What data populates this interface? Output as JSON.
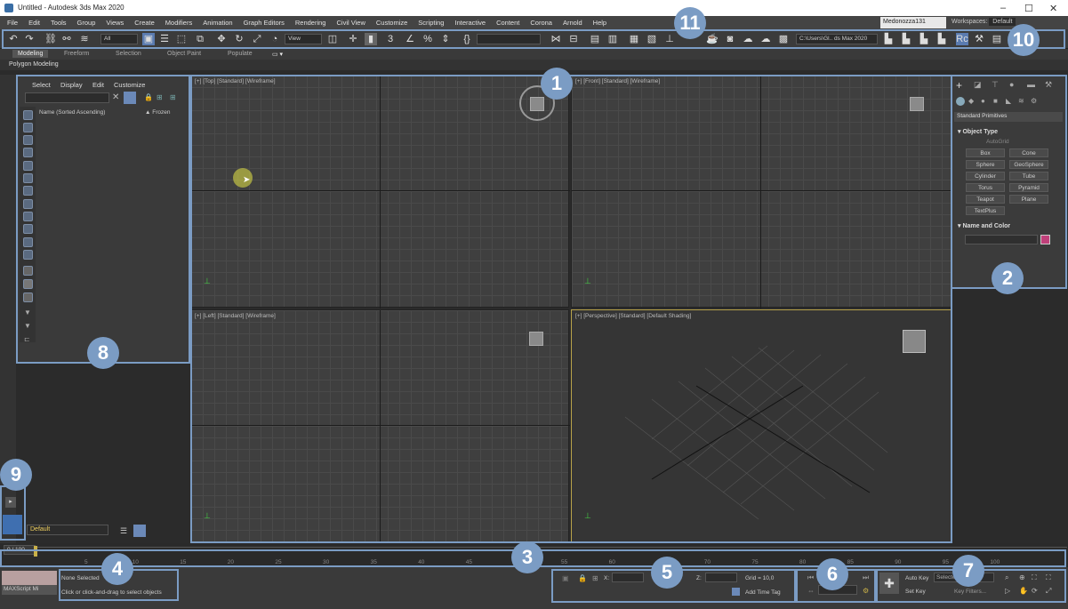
{
  "window": {
    "title": "Untitled - Autodesk 3ds Max 2020",
    "minimize": "–",
    "maximize": "☐",
    "close": "✕"
  },
  "menu": [
    "File",
    "Edit",
    "Tools",
    "Group",
    "Views",
    "Create",
    "Modifiers",
    "Animation",
    "Graph Editors",
    "Rendering",
    "Civil View",
    "Customize",
    "Scripting",
    "Interactive",
    "Content",
    "Corona",
    "Arnold",
    "Help"
  ],
  "user": "Medonozza131",
  "workspaces_label": "Workspaces:",
  "workspaces_value": "Default",
  "toolbar": {
    "selection_filter": "All",
    "ref_coord": "View",
    "path": "C:\\Users\\Gl.. ds Max 2020"
  },
  "ribbon_tabs": [
    "Modeling",
    "Freeform",
    "Selection",
    "Object Paint",
    "Populate"
  ],
  "ribbon_sub": "Polygon Modeling",
  "explorer": {
    "menu": [
      "Select",
      "Display",
      "Edit",
      "Customize"
    ],
    "col_name": "Name (Sorted Ascending)",
    "col_frozen": "▲ Frozen",
    "layer": "Default"
  },
  "viewports": {
    "top": "[+] [Top] [Standard] [Wireframe]",
    "front": "[+] [Front] [Standard] [Wireframe]",
    "left": "[+] [Left] [Standard] [Wireframe]",
    "persp": "[+] [Perspective] [Standard] [Default Shading]"
  },
  "command_panel": {
    "dropdown": "Standard Primitives",
    "object_type": "Object Type",
    "autogrid": "AutoGrid",
    "buttons": [
      "Box",
      "Cone",
      "Sphere",
      "GeoSphere",
      "Cylinder",
      "Tube",
      "Torus",
      "Pyramid",
      "Teapot",
      "Plane",
      "TextPlus"
    ],
    "name_color": "Name and Color",
    "swatch_color": "#c0407a"
  },
  "timeline": {
    "frame": "0 / 100",
    "ticks": [
      "5",
      "10",
      "15",
      "20",
      "25",
      "30",
      "35",
      "40",
      "45",
      "50",
      "55",
      "60",
      "65",
      "70",
      "75",
      "80",
      "85",
      "90",
      "95",
      "100"
    ]
  },
  "status": {
    "maxscript": "MAXScript Mi",
    "none_selected": "None Selected",
    "prompt": "Click or click-and-drag to select objects",
    "x_label": "X:",
    "z_label": "Z:",
    "grid": "Grid = 10,0",
    "add_time_tag": "Add Time Tag",
    "auto_key": "Auto Key",
    "set_key": "Set Key",
    "selected": "Selected",
    "key_filters": "Key Filters..."
  },
  "callouts": [
    "1",
    "2",
    "3",
    "4",
    "5",
    "6",
    "7",
    "8",
    "9",
    "10",
    "11"
  ],
  "accent": "#7b9cc4"
}
